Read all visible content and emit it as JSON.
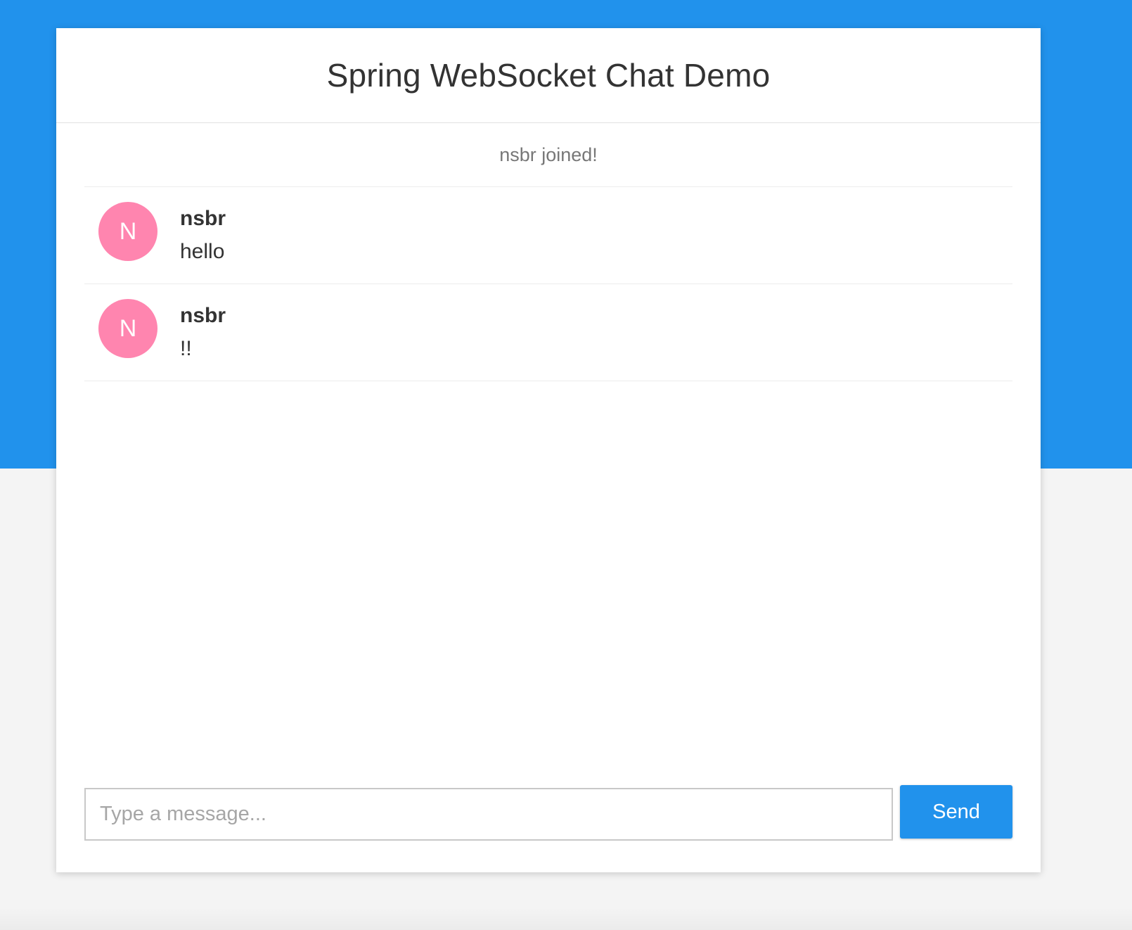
{
  "header": {
    "title": "Spring WebSocket Chat Demo"
  },
  "events": [
    {
      "text": "nsbr joined!"
    }
  ],
  "messages": [
    {
      "avatar_letter": "N",
      "avatar_color": "#ff85af",
      "sender": "nsbr",
      "content": "hello"
    },
    {
      "avatar_letter": "N",
      "avatar_color": "#ff85af",
      "sender": "nsbr",
      "content": "!!"
    }
  ],
  "form": {
    "input_value": "",
    "input_placeholder": "Type a message...",
    "send_label": "Send"
  },
  "colors": {
    "accent": "#2192ec",
    "avatar": "#ff85af",
    "page_background": "#f4f4f4"
  }
}
